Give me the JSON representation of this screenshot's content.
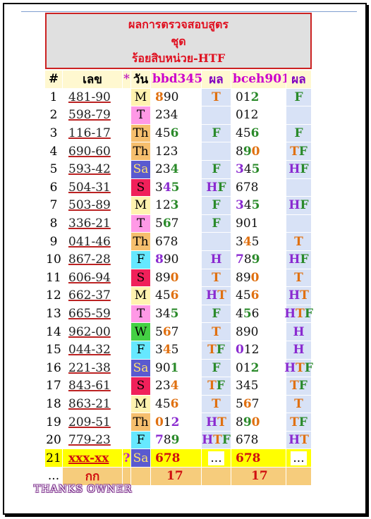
{
  "header": {
    "line1": "ผลการตรวจสอบสูตร",
    "line2": "ชุด",
    "line3": "ร้อยสิบหน่วย-HTF"
  },
  "columns": {
    "num": "#",
    "number": "เลข",
    "star": "*",
    "day": "วัน",
    "formula1": "bbd345",
    "result1": "ผล",
    "formula2": "bceh901",
    "result2": "ผล"
  },
  "day_colors": {
    "M": "#fff3b0",
    "T": "#ff99e6",
    "Th": "#f6bf6e",
    "Sa": "#5a5ad0",
    "S": "#f0205a",
    "F": "#66e8ff",
    "W": "#44d044"
  },
  "rows": [
    {
      "n": "1",
      "number": "481-90",
      "day": "M",
      "f1": [
        [
          "8",
          "o"
        ],
        [
          "9",
          ""
        ],
        [
          "0",
          ""
        ]
      ],
      "r1": "T",
      "f2": [
        [
          "0",
          ""
        ],
        [
          "1",
          ""
        ],
        [
          "2",
          "g"
        ]
      ],
      "r2": "F"
    },
    {
      "n": "2",
      "number": "598-79",
      "day": "T",
      "f1": [
        [
          "2",
          ""
        ],
        [
          "3",
          ""
        ],
        [
          "4",
          ""
        ]
      ],
      "r1": "",
      "f2": [
        [
          "0",
          ""
        ],
        [
          "1",
          ""
        ],
        [
          "2",
          ""
        ]
      ],
      "r2": ""
    },
    {
      "n": "3",
      "number": "116-17",
      "day": "Th",
      "f1": [
        [
          "4",
          ""
        ],
        [
          "5",
          ""
        ],
        [
          "6",
          "g"
        ]
      ],
      "r1": "F",
      "f2": [
        [
          "4",
          ""
        ],
        [
          "5",
          ""
        ],
        [
          "6",
          "g"
        ]
      ],
      "r2": "F"
    },
    {
      "n": "4",
      "number": "690-60",
      "day": "Th",
      "f1": [
        [
          "1",
          ""
        ],
        [
          "2",
          ""
        ],
        [
          "3",
          ""
        ]
      ],
      "r1": "",
      "f2": [
        [
          "8",
          ""
        ],
        [
          "9",
          "g"
        ],
        [
          "0",
          "o"
        ]
      ],
      "r2": "TF"
    },
    {
      "n": "5",
      "number": "593-42",
      "day": "Sa",
      "f1": [
        [
          "2",
          ""
        ],
        [
          "3",
          ""
        ],
        [
          "4",
          "g"
        ]
      ],
      "r1": "F",
      "f2": [
        [
          "3",
          "p"
        ],
        [
          "4",
          ""
        ],
        [
          "5",
          "g"
        ]
      ],
      "r2": "HF"
    },
    {
      "n": "6",
      "number": "504-31",
      "day": "S",
      "f1": [
        [
          "3",
          ""
        ],
        [
          "4",
          "p"
        ],
        [
          "5",
          "g"
        ]
      ],
      "r1": "HF",
      "f2": [
        [
          "6",
          ""
        ],
        [
          "7",
          ""
        ],
        [
          "8",
          ""
        ]
      ],
      "r2": ""
    },
    {
      "n": "7",
      "number": "503-89",
      "day": "M",
      "f1": [
        [
          "1",
          ""
        ],
        [
          "2",
          ""
        ],
        [
          "3",
          "g"
        ]
      ],
      "r1": "F",
      "f2": [
        [
          "3",
          "p"
        ],
        [
          "4",
          ""
        ],
        [
          "5",
          "g"
        ]
      ],
      "r2": "HF"
    },
    {
      "n": "8",
      "number": "336-21",
      "day": "T",
      "f1": [
        [
          "5",
          ""
        ],
        [
          "6",
          "g"
        ],
        [
          "7",
          ""
        ]
      ],
      "r1": "F",
      "f2": [
        [
          "9",
          ""
        ],
        [
          "0",
          ""
        ],
        [
          "1",
          ""
        ]
      ],
      "r2": ""
    },
    {
      "n": "9",
      "number": "041-46",
      "day": "Th",
      "f1": [
        [
          "6",
          ""
        ],
        [
          "7",
          ""
        ],
        [
          "8",
          ""
        ]
      ],
      "r1": "",
      "f2": [
        [
          "3",
          ""
        ],
        [
          "4",
          "o"
        ],
        [
          "5",
          ""
        ]
      ],
      "r2": "T"
    },
    {
      "n": "10",
      "number": "867-28",
      "day": "F",
      "f1": [
        [
          "8",
          "p"
        ],
        [
          "9",
          ""
        ],
        [
          "0",
          ""
        ]
      ],
      "r1": "H",
      "f2": [
        [
          "7",
          "p"
        ],
        [
          "8",
          ""
        ],
        [
          "9",
          "g"
        ]
      ],
      "r2": "HF"
    },
    {
      "n": "11",
      "number": "606-94",
      "day": "S",
      "f1": [
        [
          "8",
          ""
        ],
        [
          "9",
          ""
        ],
        [
          "0",
          "o"
        ]
      ],
      "r1": "T",
      "f2": [
        [
          "8",
          ""
        ],
        [
          "9",
          ""
        ],
        [
          "0",
          "o"
        ]
      ],
      "r2": "T"
    },
    {
      "n": "12",
      "number": "662-37",
      "day": "M",
      "f1": [
        [
          "4",
          ""
        ],
        [
          "5",
          ""
        ],
        [
          "6",
          "o"
        ]
      ],
      "r1": "HT",
      "f2": [
        [
          "4",
          ""
        ],
        [
          "5",
          ""
        ],
        [
          "6",
          "o"
        ]
      ],
      "r2": "HT"
    },
    {
      "n": "13",
      "number": "665-59",
      "day": "T",
      "f1": [
        [
          "3",
          ""
        ],
        [
          "4",
          ""
        ],
        [
          "5",
          "g"
        ]
      ],
      "r1": "F",
      "f2": [
        [
          "4",
          ""
        ],
        [
          "5",
          "g"
        ],
        [
          "6",
          ""
        ]
      ],
      "r2": "HTF"
    },
    {
      "n": "14",
      "number": "962-00",
      "day": "W",
      "f1": [
        [
          "5",
          ""
        ],
        [
          "6",
          "o"
        ],
        [
          "7",
          ""
        ]
      ],
      "r1": "T",
      "f2": [
        [
          "8",
          ""
        ],
        [
          "9",
          ""
        ],
        [
          "0",
          ""
        ]
      ],
      "r2": "H"
    },
    {
      "n": "15",
      "number": "044-32",
      "day": "F",
      "f1": [
        [
          "3",
          ""
        ],
        [
          "4",
          "o"
        ],
        [
          "5",
          ""
        ]
      ],
      "r1": "TF",
      "f2": [
        [
          "0",
          "p"
        ],
        [
          "1",
          ""
        ],
        [
          "2",
          ""
        ]
      ],
      "r2": "H"
    },
    {
      "n": "16",
      "number": "221-38",
      "day": "Sa",
      "f1": [
        [
          "9",
          ""
        ],
        [
          "0",
          ""
        ],
        [
          "1",
          "g"
        ]
      ],
      "r1": "F",
      "f2": [
        [
          "0",
          ""
        ],
        [
          "1",
          ""
        ],
        [
          "2",
          "g"
        ]
      ],
      "r2": "HTF"
    },
    {
      "n": "17",
      "number": "843-61",
      "day": "S",
      "f1": [
        [
          "2",
          ""
        ],
        [
          "3",
          ""
        ],
        [
          "4",
          "o"
        ]
      ],
      "r1": "TF",
      "f2": [
        [
          "3",
          ""
        ],
        [
          "4",
          ""
        ],
        [
          "5",
          ""
        ]
      ],
      "r2": "TF"
    },
    {
      "n": "18",
      "number": "863-21",
      "day": "M",
      "f1": [
        [
          "4",
          ""
        ],
        [
          "5",
          ""
        ],
        [
          "6",
          "o"
        ]
      ],
      "r1": "T",
      "f2": [
        [
          "5",
          ""
        ],
        [
          "6",
          "o"
        ],
        [
          "7",
          ""
        ]
      ],
      "r2": "T"
    },
    {
      "n": "19",
      "number": "209-51",
      "day": "Th",
      "f1": [
        [
          "0",
          "o"
        ],
        [
          "1",
          ""
        ],
        [
          "2",
          "p"
        ]
      ],
      "r1": "HT",
      "f2": [
        [
          "8",
          ""
        ],
        [
          "9",
          "g"
        ],
        [
          "0",
          "o"
        ]
      ],
      "r2": "TF"
    },
    {
      "n": "20",
      "number": "779-23",
      "day": "F",
      "f1": [
        [
          "7",
          "p"
        ],
        [
          "8",
          ""
        ],
        [
          "9",
          "g"
        ]
      ],
      "r1": "HTF",
      "f2": [
        [
          "6",
          ""
        ],
        [
          "7",
          ""
        ],
        [
          "8",
          ""
        ]
      ],
      "r2": "HT"
    }
  ],
  "pending_row": {
    "n": "21",
    "number": "xxx-xx",
    "star": "?",
    "day": "Sa",
    "f1": "678",
    "r1": "...",
    "f2": "678",
    "r2": "..."
  },
  "footer_row": {
    "n": "...",
    "label": "กก",
    "count1": "17",
    "count2": "17"
  },
  "thanks": "THANKS OWNER"
}
